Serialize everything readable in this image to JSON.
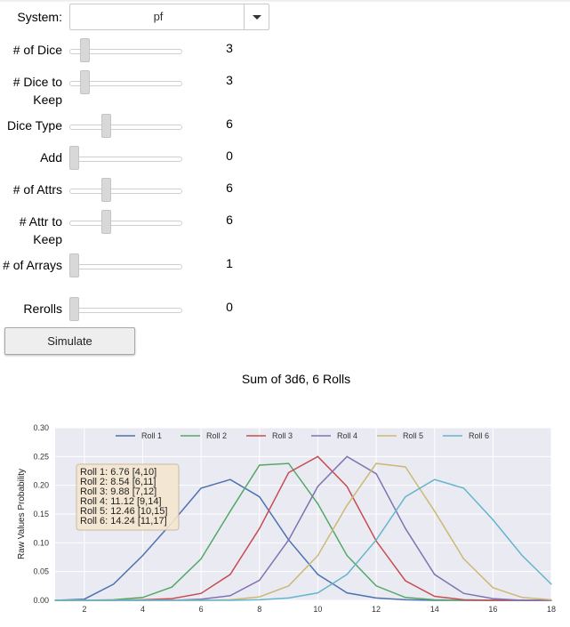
{
  "form": {
    "system": {
      "label": "System:",
      "value": "pf"
    },
    "sliders": [
      {
        "label": "# of Dice",
        "value": "3",
        "fraction": 0.1
      },
      {
        "label": "# Dice to Keep",
        "value": "3",
        "fraction": 0.1
      },
      {
        "label": "Dice Type",
        "value": "6",
        "fraction": 0.31
      },
      {
        "label": "Add",
        "value": "0",
        "fraction": 0.0
      },
      {
        "label": "# of Attrs",
        "value": "6",
        "fraction": 0.31
      },
      {
        "label": "# Attr to Keep",
        "value": "6",
        "fraction": 0.31
      },
      {
        "label": "# of Arrays",
        "value": "1",
        "fraction": 0.0
      },
      {
        "label": "Rerolls",
        "value": "0",
        "fraction": 0.0
      }
    ],
    "simulate_label": "Simulate"
  },
  "chart_data": {
    "type": "line",
    "title": "Sum of 3d6, 6 Rolls",
    "ylabel": "Raw Values Probability",
    "xlabel": "",
    "xlim": [
      1,
      18
    ],
    "ylim": [
      0,
      0.3
    ],
    "x_ticks": [
      2,
      4,
      6,
      8,
      10,
      12,
      14,
      16,
      18
    ],
    "y_ticks": [
      0.0,
      0.05,
      0.1,
      0.15,
      0.2,
      0.25,
      0.3
    ],
    "y_tick_labels": [
      "0.00",
      "0.05",
      "0.10",
      "0.15",
      "0.20",
      "0.25",
      "0.30"
    ],
    "grid": true,
    "legend_position": "top",
    "series": [
      {
        "name": "Roll 1",
        "color": "#4c72b0",
        "x": [
          1,
          2,
          3,
          4,
          5,
          6,
          7,
          8,
          9,
          10,
          11,
          12,
          13,
          14,
          15,
          16,
          17,
          18
        ],
        "y": [
          0,
          0.002,
          0.028,
          0.078,
          0.135,
          0.195,
          0.21,
          0.18,
          0.105,
          0.045,
          0.013,
          0.004,
          0.001,
          0,
          0,
          0,
          0,
          0
        ]
      },
      {
        "name": "Roll 2",
        "color": "#55a868",
        "x": [
          1,
          2,
          3,
          4,
          5,
          6,
          7,
          8,
          9,
          10,
          11,
          12,
          13,
          14,
          15,
          16,
          17,
          18
        ],
        "y": [
          0,
          0,
          0.001,
          0.005,
          0.023,
          0.072,
          0.155,
          0.235,
          0.238,
          0.168,
          0.078,
          0.025,
          0.005,
          0.001,
          0,
          0,
          0,
          0
        ]
      },
      {
        "name": "Roll 3",
        "color": "#c44e52",
        "x": [
          1,
          2,
          3,
          4,
          5,
          6,
          7,
          8,
          9,
          10,
          11,
          12,
          13,
          14,
          15,
          16,
          17,
          18
        ],
        "y": [
          0,
          0,
          0,
          0.001,
          0.003,
          0.012,
          0.045,
          0.125,
          0.222,
          0.25,
          0.198,
          0.103,
          0.034,
          0.007,
          0.001,
          0,
          0,
          0
        ]
      },
      {
        "name": "Roll 4",
        "color": "#8172b2",
        "x": [
          1,
          2,
          3,
          4,
          5,
          6,
          7,
          8,
          9,
          10,
          11,
          12,
          13,
          14,
          15,
          16,
          17,
          18
        ],
        "y": [
          0,
          0,
          0,
          0,
          0,
          0.002,
          0.008,
          0.035,
          0.105,
          0.198,
          0.25,
          0.22,
          0.125,
          0.045,
          0.012,
          0.003,
          0,
          0
        ]
      },
      {
        "name": "Roll 5",
        "color": "#ccb974",
        "x": [
          1,
          2,
          3,
          4,
          5,
          6,
          7,
          8,
          9,
          10,
          11,
          12,
          13,
          14,
          15,
          16,
          17,
          18
        ],
        "y": [
          0,
          0,
          0,
          0,
          0,
          0,
          0.001,
          0.006,
          0.025,
          0.078,
          0.165,
          0.238,
          0.232,
          0.155,
          0.072,
          0.022,
          0.005,
          0.001
        ]
      },
      {
        "name": "Roll 6",
        "color": "#64b5cd",
        "x": [
          1,
          2,
          3,
          4,
          5,
          6,
          7,
          8,
          9,
          10,
          11,
          12,
          13,
          14,
          15,
          16,
          17,
          18
        ],
        "y": [
          0,
          0,
          0,
          0,
          0,
          0,
          0,
          0.001,
          0.004,
          0.013,
          0.045,
          0.105,
          0.18,
          0.21,
          0.195,
          0.14,
          0.078,
          0.028
        ]
      }
    ],
    "annotation_lines": [
      "Roll 1: 6.76 [4,10]",
      "Roll 2: 8.54 [6,11]",
      "Roll 3: 9.88 [7,12]",
      "Roll 4: 11.12 [9,14]",
      "Roll 5: 12.46 [10,15]",
      "Roll 6: 14.24 [11,17]"
    ],
    "annotation_bg": "#f5e6d0"
  }
}
